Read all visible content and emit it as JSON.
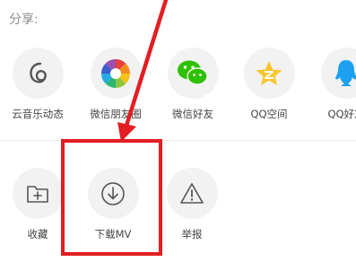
{
  "share": {
    "label": "分享:",
    "items": [
      {
        "label": "云音乐动态",
        "icon": "cloud-music-icon"
      },
      {
        "label": "微信朋友圈",
        "icon": "wechat-moments-icon"
      },
      {
        "label": "微信好友",
        "icon": "wechat-icon"
      },
      {
        "label": "QQ空间",
        "icon": "qzone-icon"
      },
      {
        "label": "QQ好友",
        "icon": "qq-icon"
      }
    ]
  },
  "actions": {
    "items": [
      {
        "label": "收藏",
        "icon": "folder-plus-icon"
      },
      {
        "label": "下载MV",
        "icon": "download-icon"
      },
      {
        "label": "举报",
        "icon": "warning-icon"
      }
    ]
  },
  "annotation": {
    "highlight_color": "#e21e22"
  }
}
